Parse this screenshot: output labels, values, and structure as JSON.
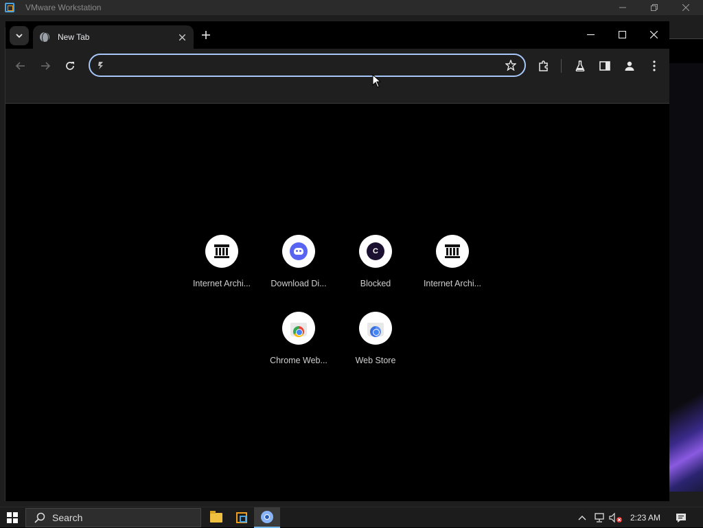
{
  "vmware": {
    "title": "VMware Workstation"
  },
  "browser": {
    "tab": {
      "title": "New Tab"
    },
    "omnibox": {
      "value": "",
      "placeholder": ""
    },
    "shortcuts": [
      {
        "label": "Internet Archi...",
        "icon": "archive-icon"
      },
      {
        "label": "Download Di...",
        "icon": "discord-icon"
      },
      {
        "label": "Blocked",
        "icon": "c-letter-icon",
        "letter": "C"
      },
      {
        "label": "Internet Archi...",
        "icon": "archive-icon"
      },
      {
        "label": "Chrome Web...",
        "icon": "chrome-web-store-icon"
      },
      {
        "label": "Web Store",
        "icon": "web-store-icon"
      }
    ]
  },
  "taskbar": {
    "search_label": "Search",
    "clock": "2:23 AM"
  },
  "colors": {
    "omnibox_focus": "#a8c7fa",
    "toolbar_bg": "#1f1f1f",
    "discord": "#5865f2",
    "taskbar_accent": "#76b9ed"
  }
}
